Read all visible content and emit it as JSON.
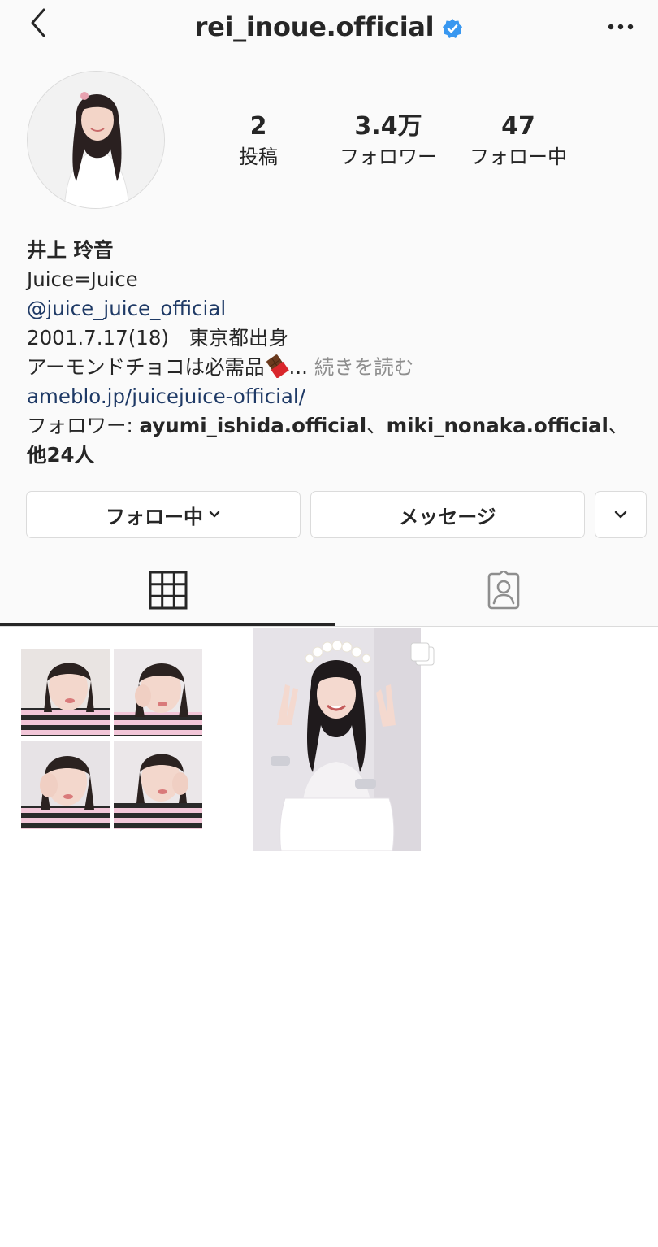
{
  "header": {
    "username": "rei_inoue.official",
    "back_icon": "chevron-left-icon",
    "verified_icon": "verified-badge-icon",
    "more_icon": "more-horizontal-icon"
  },
  "profile": {
    "avatar_icon": "profile-photo",
    "stats": {
      "posts": {
        "value": "2",
        "label": "投稿"
      },
      "followers": {
        "value": "3.4万",
        "label": "フォロワー"
      },
      "following": {
        "value": "47",
        "label": "フォロー中"
      }
    }
  },
  "bio": {
    "name": "井上 玲音",
    "line1": "Juice=Juice",
    "mention": "@juice_juice_official",
    "line3": "2001.7.17(18)　東京都出身",
    "line4": "アーモンドチョコは必需品",
    "ellipsis": "...",
    "more": "続きを読む",
    "url": "ameblo.jp/juicejuice-official/",
    "followed_by_prefix": "フォロワー: ",
    "followed_by_1": "ayumi_ishida.official",
    "sep": "、",
    "followed_by_2": "miki_nonaka.official",
    "sep2": "、",
    "followed_by_more": "他24人"
  },
  "actions": {
    "following_label": "フォロー中",
    "message_label": "メッセージ"
  },
  "tabs": [
    {
      "name": "grid",
      "icon": "grid-icon",
      "active": true
    },
    {
      "name": "tagged",
      "icon": "tagged-person-icon",
      "active": false
    }
  ],
  "posts": [
    {
      "kind": "collage",
      "icon": "photo-collage"
    },
    {
      "kind": "carousel",
      "icon": "multiple-photos-icon"
    }
  ],
  "colors": {
    "link": "#1f3a66",
    "verified": "#3897f0",
    "muted": "#8e8e8e",
    "border": "#dbdbdb"
  }
}
